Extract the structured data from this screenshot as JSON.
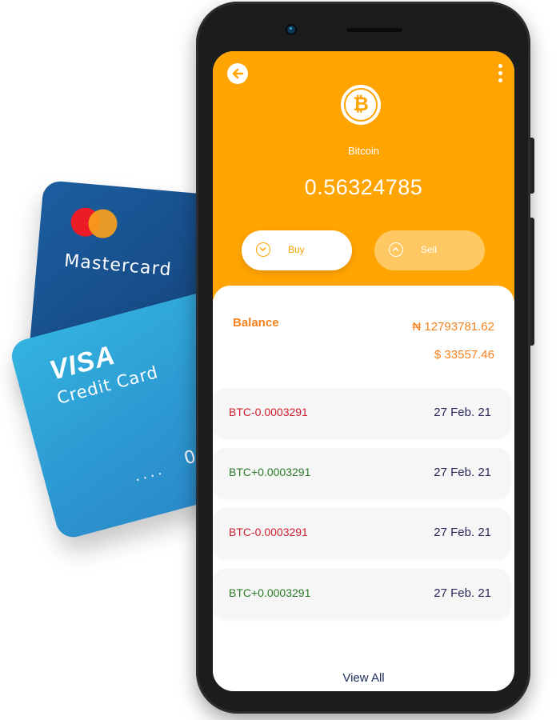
{
  "cards": {
    "mastercard": {
      "label": "Mastercard",
      "colors": {
        "red": "#eb1c26",
        "orange": "#f99f1b"
      }
    },
    "visa": {
      "brand": "VISA",
      "subtitle": "Credit Card",
      "masked_digits": "....",
      "last_digits": "0909"
    }
  },
  "app": {
    "accent": "#ffa400",
    "header": {
      "back_icon": "arrow-left-icon",
      "menu_icon": "kebab-menu-icon",
      "coin_icon": "bitcoin-icon",
      "coin_symbol": "₿",
      "coin_name": "Bitcoin",
      "coin_amount": "0.56324785"
    },
    "actions": {
      "buy_label": "Buy",
      "sell_label": "Sell"
    },
    "balance": {
      "label": "Balance",
      "ngn": "₦ 12793781.62",
      "usd": "$ 33557.46"
    },
    "transactions": [
      {
        "amount": "BTC-0.0003291",
        "date": "27 Feb. 21",
        "direction": "out"
      },
      {
        "amount": "BTC+0.0003291",
        "date": "27 Feb. 21",
        "direction": "in"
      },
      {
        "amount": "BTC-0.0003291",
        "date": "27 Feb. 21",
        "direction": "out"
      },
      {
        "amount": "BTC+0.0003291",
        "date": "27 Feb. 21",
        "direction": "in"
      }
    ],
    "view_all_label": "View All"
  }
}
